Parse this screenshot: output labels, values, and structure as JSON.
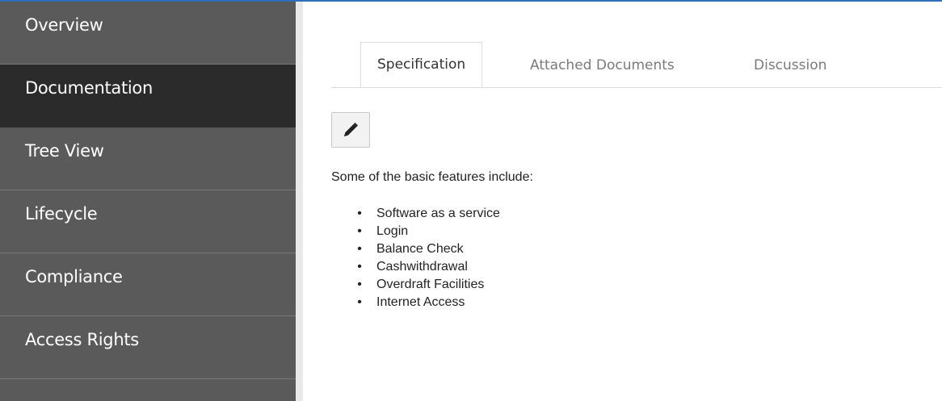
{
  "sidebar": {
    "items": [
      {
        "label": "Overview",
        "active": false
      },
      {
        "label": "Documentation",
        "active": true
      },
      {
        "label": "Tree View",
        "active": false
      },
      {
        "label": "Lifecycle",
        "active": false
      },
      {
        "label": "Compliance",
        "active": false
      },
      {
        "label": "Access Rights",
        "active": false
      }
    ]
  },
  "tabs": [
    {
      "label": "Specification",
      "active": true
    },
    {
      "label": "Attached Documents",
      "active": false
    },
    {
      "label": "Discussion",
      "active": false
    }
  ],
  "toolbar": {
    "edit_icon": "pencil-icon"
  },
  "content": {
    "intro": "Some of the basic features include:",
    "features": [
      "Software as a service",
      "Login",
      "Balance Check",
      "Cashwithdrawal",
      "Overdraft Facilities",
      "Internet Access"
    ]
  },
  "colors": {
    "sidebar_bg": "#5a5a5a",
    "sidebar_active_bg": "#2b2b2b",
    "accent": "#2f6fba"
  }
}
